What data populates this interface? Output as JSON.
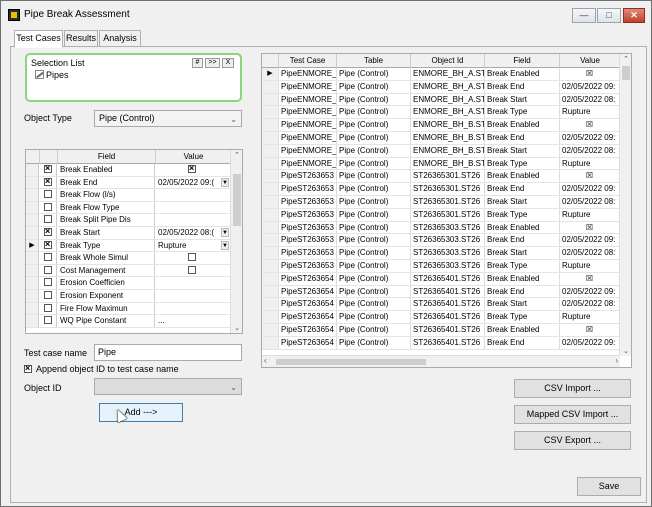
{
  "window": {
    "title": "Pipe Break Assessment",
    "icon": "app-icon"
  },
  "tabs": [
    {
      "label": "Test Cases",
      "active": true
    },
    {
      "label": "Results"
    },
    {
      "label": "Analysis"
    }
  ],
  "selection_list": {
    "label": "Selection List",
    "buttons": [
      "#",
      ">>",
      "X"
    ],
    "items": [
      "Pipes"
    ]
  },
  "object_type": {
    "label": "Object Type",
    "value": "Pipe (Control)"
  },
  "field_grid": {
    "headers": [
      "Field",
      "Value"
    ],
    "rows": [
      {
        "checked": true,
        "field": "Break Enabled",
        "value": "",
        "value_checkbox": true,
        "value_checked": true,
        "dropdown": false,
        "current": false
      },
      {
        "checked": true,
        "field": "Break End",
        "value": "02/05/2022 09:(",
        "value_checkbox": false,
        "dropdown": true,
        "current": false
      },
      {
        "checked": false,
        "field": "Break Flow (l/s)",
        "value": "",
        "value_checkbox": false,
        "dropdown": false,
        "current": false
      },
      {
        "checked": false,
        "field": "Break Flow Type",
        "value": "",
        "value_checkbox": false,
        "dropdown": false,
        "current": false
      },
      {
        "checked": false,
        "field": "Break Split Pipe Dis",
        "value": "",
        "value_checkbox": false,
        "dropdown": false,
        "current": false
      },
      {
        "checked": true,
        "field": "Break Start",
        "value": "02/05/2022 08:(",
        "value_checkbox": false,
        "dropdown": true,
        "current": false
      },
      {
        "checked": true,
        "field": "Break Type",
        "value": "Rupture",
        "value_checkbox": false,
        "dropdown": true,
        "current": true
      },
      {
        "checked": false,
        "field": "Break Whole Simul",
        "value": "",
        "value_checkbox": true,
        "value_checked": false,
        "dropdown": false,
        "current": false
      },
      {
        "checked": false,
        "field": "Cost Management",
        "value": "",
        "value_checkbox": true,
        "value_checked": false,
        "dropdown": false,
        "current": false
      },
      {
        "checked": false,
        "field": "Erosion Coefficien",
        "value": "",
        "value_checkbox": false,
        "dropdown": false,
        "current": false
      },
      {
        "checked": false,
        "field": "Erosion Exponent",
        "value": "",
        "value_checkbox": false,
        "dropdown": false,
        "current": false
      },
      {
        "checked": false,
        "field": "Fire Flow Maximun",
        "value": "",
        "value_checkbox": false,
        "dropdown": false,
        "current": false
      },
      {
        "checked": false,
        "field": "WQ Pipe Constant",
        "value": "...",
        "value_checkbox": false,
        "dropdown": false,
        "current": false
      }
    ]
  },
  "test_case_name": {
    "label": "Test case name",
    "value": "Pipe"
  },
  "append_object_id": {
    "label": "Append object ID to test case name",
    "checked": true
  },
  "object_id": {
    "label": "Object ID",
    "value": ""
  },
  "add_button": "Add --->",
  "results_grid": {
    "headers": [
      "Test Case",
      "Table",
      "Object Id",
      "Field",
      "Value"
    ],
    "rows": [
      [
        "PipeENMORE_",
        "Pipe (Control)",
        "ENMORE_BH_A.ST2",
        "Break Enabled",
        "☒"
      ],
      [
        "PipeENMORE_",
        "Pipe (Control)",
        "ENMORE_BH_A.ST2",
        "Break End",
        "02/05/2022 09:"
      ],
      [
        "PipeENMORE_",
        "Pipe (Control)",
        "ENMORE_BH_A.ST2",
        "Break Start",
        "02/05/2022 08:"
      ],
      [
        "PipeENMORE_",
        "Pipe (Control)",
        "ENMORE_BH_A.ST2",
        "Break Type",
        "Rupture"
      ],
      [
        "PipeENMORE_",
        "Pipe (Control)",
        "ENMORE_BH_B.ST2",
        "Break Enabled",
        "☒"
      ],
      [
        "PipeENMORE_",
        "Pipe (Control)",
        "ENMORE_BH_B.ST2",
        "Break End",
        "02/05/2022 09:"
      ],
      [
        "PipeENMORE_",
        "Pipe (Control)",
        "ENMORE_BH_B.ST2",
        "Break Start",
        "02/05/2022 08:"
      ],
      [
        "PipeENMORE_",
        "Pipe (Control)",
        "ENMORE_BH_B.ST2",
        "Break Type",
        "Rupture"
      ],
      [
        "PipeST263653",
        "Pipe (Control)",
        "ST26365301.ST26",
        "Break Enabled",
        "☒"
      ],
      [
        "PipeST263653",
        "Pipe (Control)",
        "ST26365301.ST26",
        "Break End",
        "02/05/2022 09:"
      ],
      [
        "PipeST263653",
        "Pipe (Control)",
        "ST26365301.ST26",
        "Break Start",
        "02/05/2022 08:"
      ],
      [
        "PipeST263653",
        "Pipe (Control)",
        "ST26365301.ST26",
        "Break Type",
        "Rupture"
      ],
      [
        "PipeST263653",
        "Pipe (Control)",
        "ST26365303.ST26",
        "Break Enabled",
        "☒"
      ],
      [
        "PipeST263653",
        "Pipe (Control)",
        "ST26365303.ST26",
        "Break End",
        "02/05/2022 09:"
      ],
      [
        "PipeST263653",
        "Pipe (Control)",
        "ST26365303.ST26",
        "Break Start",
        "02/05/2022 08:"
      ],
      [
        "PipeST263653",
        "Pipe (Control)",
        "ST26365303.ST26",
        "Break Type",
        "Rupture"
      ],
      [
        "PipeST263654",
        "Pipe (Control)",
        "ST26365401.ST26",
        "Break Enabled",
        "☒"
      ],
      [
        "PipeST263654",
        "Pipe (Control)",
        "ST26365401.ST26",
        "Break End",
        "02/05/2022 09:"
      ],
      [
        "PipeST263654",
        "Pipe (Control)",
        "ST26365401.ST26",
        "Break Start",
        "02/05/2022 08:"
      ],
      [
        "PipeST263654",
        "Pipe (Control)",
        "ST26365401.ST26",
        "Break Type",
        "Rupture"
      ],
      [
        "PipeST263654",
        "Pipe (Control)",
        "ST26365401.ST26",
        "Break Enabled",
        "☒"
      ],
      [
        "PipeST263654",
        "Pipe (Control)",
        "ST26365401.ST26",
        "Break End",
        "02/05/2022 09:"
      ]
    ]
  },
  "buttons": {
    "csv_import": "CSV Import ...",
    "mapped_csv_import": "Mapped CSV Import ...",
    "csv_export": "CSV Export ...",
    "save": "Save"
  }
}
